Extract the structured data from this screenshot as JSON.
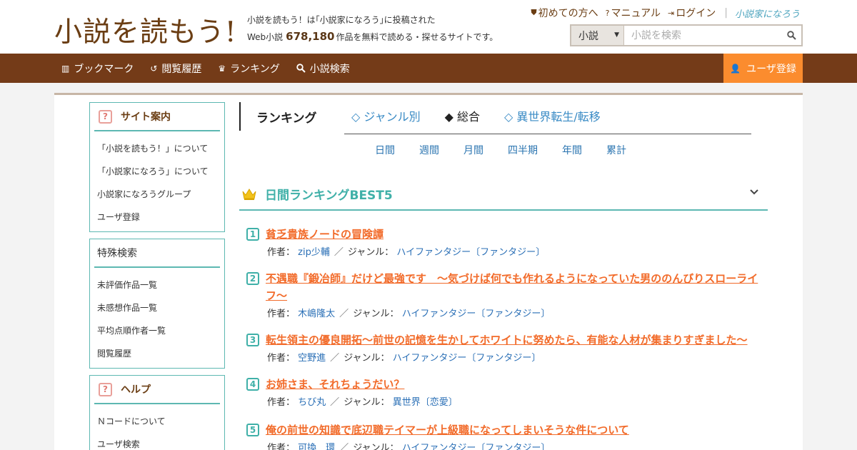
{
  "header": {
    "logo_main": "小説を読もう!",
    "tagline_line1": "小説を読もう！は｢小説家になろう｣に投稿された",
    "tagline_pre": "Web小説",
    "work_count": "678,180",
    "tagline_post": "作品を無料で読める・探せるサイトです。",
    "links": {
      "first_time": "初めての方へ",
      "manual": "マニュアル",
      "login": "ログイン",
      "narou": "小説家になろう"
    },
    "search": {
      "category": "小説",
      "placeholder": "小説を検索"
    }
  },
  "nav": {
    "items": [
      {
        "label": "ブックマーク",
        "icon": "bookmark-icon"
      },
      {
        "label": "閲覧履歴",
        "icon": "history-icon"
      },
      {
        "label": "ランキング",
        "icon": "crown-icon"
      },
      {
        "label": "小説検索",
        "icon": "search-icon"
      }
    ],
    "register": "ユーザ登録"
  },
  "sidebar": {
    "site_guide": {
      "title": "サイト案内",
      "items": [
        "「小説を読もう！」について",
        "「小説家になろう」について",
        "小説家になろうグループ",
        "ユーザ登録"
      ]
    },
    "special_search": {
      "title": "特殊検索",
      "items": [
        "未評価作品一覧",
        "未感想作品一覧",
        "平均点順作者一覧",
        "閲覧履歴"
      ]
    },
    "help": {
      "title": "ヘルプ",
      "items": [
        "Ｎコードについて",
        "ユーザ検索"
      ]
    }
  },
  "ranking": {
    "heading": "ランキング",
    "tabs": [
      "◇ ジャンル別",
      "◆ 総合",
      "◇ 異世界転生/転移"
    ],
    "periods": [
      "日間",
      "週間",
      "月間",
      "四半期",
      "年間",
      "累計"
    ],
    "best_title": "日間ランキングBEST5",
    "author_label": "作者：",
    "genre_label": "ジャンル：",
    "entries": [
      {
        "rank": "1",
        "title": "貧乏貴族ノードの冒険譚",
        "author": "zip少輔",
        "genre": "ハイファンタジー〔ファンタジー〕"
      },
      {
        "rank": "2",
        "title": "不遇職『鍛冶師』だけど最強です　～気づけば何でも作れるようになっていた男ののんびりスローライフ～",
        "author": "木嶋隆太",
        "genre": "ハイファンタジー〔ファンタジー〕"
      },
      {
        "rank": "3",
        "title": "転生領主の優良開拓〜前世の記憶を生かしてホワイトに努めたら、有能な人材が集まりすぎました〜",
        "author": "空野進",
        "genre": "ハイファンタジー〔ファンタジー〕"
      },
      {
        "rank": "4",
        "title": "お姉さま、それちょうだい？",
        "author": "ちび丸",
        "genre": "異世界〔恋愛〕"
      },
      {
        "rank": "5",
        "title": "俺の前世の知識で底辺職テイマーが上級職になってしまいそうな件について",
        "author": "可換　環",
        "genre": "ハイファンタジー〔ファンタジー〕"
      }
    ]
  }
}
